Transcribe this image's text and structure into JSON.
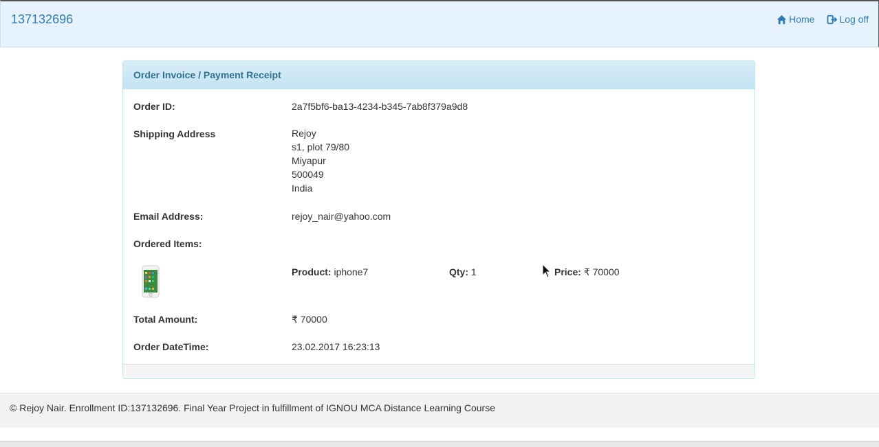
{
  "navbar": {
    "brand": "137132696",
    "home_label": "Home",
    "logoff_label": "Log off"
  },
  "panel": {
    "title": "Order Invoice / Payment Receipt",
    "order_id_label": "Order ID:",
    "order_id": "2a7f5bf6-ba13-4234-b345-7ab8f379a9d8",
    "shipping_label": "Shipping Address",
    "shipping_address": [
      "Rejoy",
      "s1, plot 79/80",
      "Miyapur",
      "500049",
      "India"
    ],
    "email_label": "Email Address:",
    "email": "rejoy_nair@yahoo.com",
    "ordered_items_label": "Ordered Items:",
    "items": [
      {
        "image_icon": "iphone-image",
        "product_label": "Product:",
        "product": "iphone7",
        "qty_label": "Qty:",
        "qty": "1",
        "price_label": "Price:",
        "price": "₹ 70000"
      }
    ],
    "total_label": "Total Amount:",
    "total": "₹ 70000",
    "datetime_label": "Order DateTime:",
    "datetime": "23.02.2017 16:23:13"
  },
  "footer": {
    "text": "© Rejoy Nair. Enrollment ID:137132696. Final Year Project in fulfillment of IGNOU MCA Distance Learning Course"
  },
  "colors": {
    "navbar_bg": "#e6f2fc",
    "link": "#2f7bb6",
    "panel_heading_text": "#31708f",
    "panel_border": "#bce8f1"
  }
}
